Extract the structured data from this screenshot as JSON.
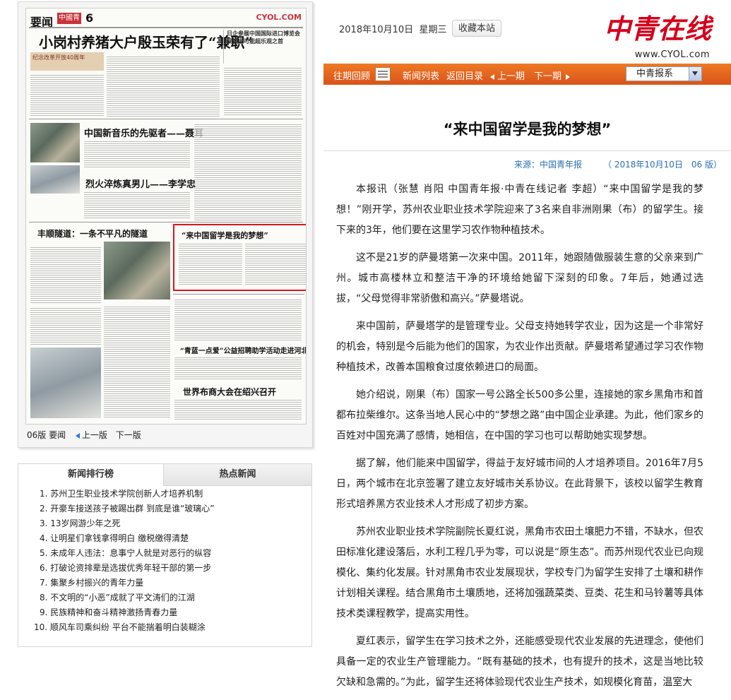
{
  "header": {
    "date": "2018年10月10日",
    "weekday": "星期三",
    "bookmark_label": "收藏本站",
    "logo_text": "中青在线",
    "logo_url": "www.CYOL.com"
  },
  "nav": {
    "items": [
      "往期回顾",
      "新闻列表",
      "返回目录",
      "上一期",
      "下一期"
    ],
    "paper_select": "中青报系"
  },
  "thumbnail": {
    "section": "要闻",
    "badge": "中國青年報",
    "page_number": "6",
    "site_url": "CYOL.COM",
    "headline": "小岗村养猪大户殷玉荣有了“兼职”",
    "sidebox": "日企参展中国国际进口博览会 规模庞可能超乐观之首",
    "band": "纪念改革开放40周年",
    "sub1": "中国新音乐的先驱者——聂耳",
    "sub2": "烈火淬炼真男儿——李学忠",
    "sub3": "丰顺隧道：一条不平凡的隧道",
    "sub4": "“青蓝一点爱”公益招聘助学活动走进河北兴隆",
    "sub5": "世界布商大会在绍兴召开",
    "highlight_title": "“来中国留学是我的梦想”",
    "footer_page": "06版 要闻",
    "prev_page": "上一版",
    "next_page": "下一版"
  },
  "rankings": {
    "tab_active": "新闻排行榜",
    "tab_inactive": "热点新闻",
    "items": [
      "1. 苏州卫生职业技术学院创新人才培养机制",
      "2. 开豪车接送孩子被踢出群 到底是谁“玻璃心”",
      "3. 13岁网游少年之死",
      "4. 让明星们拿钱拿得明白 缴税缴得清楚",
      "5. 未成年人违法：息事宁人就是对恶行的纵容",
      "6. 打破论资排辈是选拔优秀年轻干部的第一步",
      "7. 集聚乡村振兴的青年力量",
      "8. 不文明的“小恶”成就了平文涛们的江湖",
      "9. 民族精神和奋斗精神激扬青春力量",
      "10. 顺风车司乘纠纷 平台不能揣着明白装糊涂"
    ]
  },
  "article": {
    "title": "“来中国留学是我的梦想”",
    "source": "来源：中国青年报",
    "date": "（ 2018年10月10日",
    "page": "06 版）",
    "paragraphs": [
      "本报讯（张慧 肖阳 中国青年报·中青在线记者 李超）“来中国留学是我的梦想！”刚开学，苏州农业职业技术学院迎来了3名来自非洲刚果（布）的留学生。接下来的3年，他们要在这里学习农作物种植技术。",
      "这不是21岁的萨曼塔第一次来中国。2011年，她跟随做服装生意的父亲来到广州。城市高楼林立和整洁干净的环境给她留下深刻的印象。7年后，她通过选拔，“父母觉得非常骄傲和高兴。”萨曼塔说。",
      "来中国前，萨曼塔学的是管理专业。父母支持她转学农业，因为这是一个非常好的机会，特别是今后能为他们的国家，为农业作出贡献。萨曼塔希望通过学习农作物种植技术，改善本国粮食过度依赖进口的局面。",
      "她介绍说，刚果（布）国家一号公路全长500多公里，连接她的家乡黑角市和首都布拉柴维尔。这条当地人民心中的“梦想之路”由中国企业承建。为此，他们家乡的百姓对中国充满了感情，她相信，在中国的学习也可以帮助她实现梦想。",
      "据了解，他们能来中国留学，得益于友好城市间的人才培养项目。2016年7月5日，两个城市在北京签署了建立友好城市关系协议。在此背景下，该校以留学生教育形式培养黑方农业技术人才形成了初步方案。",
      "苏州农业职业技术学院副院长夏红说，黑角市农田土壤肥力不错，不缺水，但农田标准化建设落后，水利工程几乎为零，可以说是“原生态”。而苏州现代农业已向规模化、集约化发展。针对黑角市农业发展现状，学校专门为留学生安排了土壤和耕作计划相关课程。结合黑角市土壤质地，还将加强蔬菜类、豆类、花生和马铃薯等具体技术类课程教学，提高实用性。",
      "夏红表示，留学生在学习技术之外，还能感受现代农业发展的先进理念，使他们具备一定的农业生产管理能力。“既有基础的技术，也有提升的技术，这是当地比较欠缺和急需的。”为此，留学生还将体验现代农业生产技术，如规模化育苗，温室大"
    ]
  }
}
